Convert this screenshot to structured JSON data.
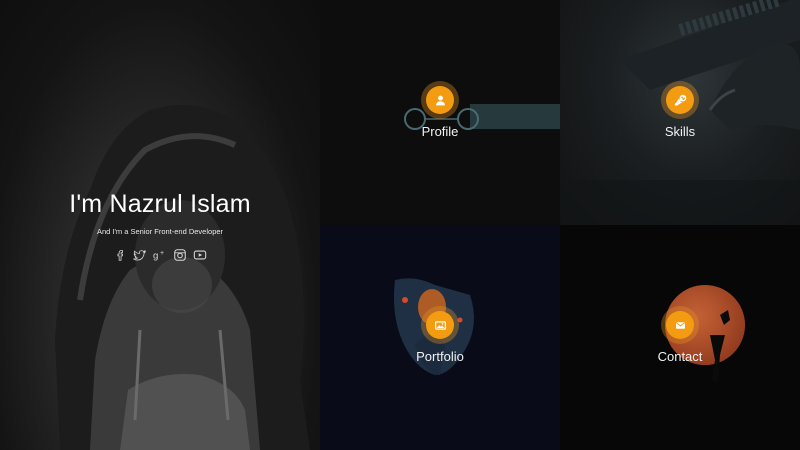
{
  "hero": {
    "title": "I'm Nazrul Islam",
    "subtitle": "And I'm a Senior Front-end Developer",
    "socials": [
      {
        "name": "facebook-icon"
      },
      {
        "name": "twitter-icon"
      },
      {
        "name": "google-plus-icon"
      },
      {
        "name": "instagram-icon"
      },
      {
        "name": "youtube-icon"
      }
    ]
  },
  "tiles": {
    "profile": {
      "label": "Profile",
      "icon": "user-icon"
    },
    "skills": {
      "label": "Skills",
      "icon": "wrench-icon"
    },
    "portfolio": {
      "label": "Portfolio",
      "icon": "image-icon"
    },
    "contact": {
      "label": "Contact",
      "icon": "envelope-icon"
    }
  },
  "colors": {
    "accent": "#f39c12",
    "accent_glow": "#e8962380",
    "background": "#0c0c0c",
    "text": "#ffffff"
  }
}
